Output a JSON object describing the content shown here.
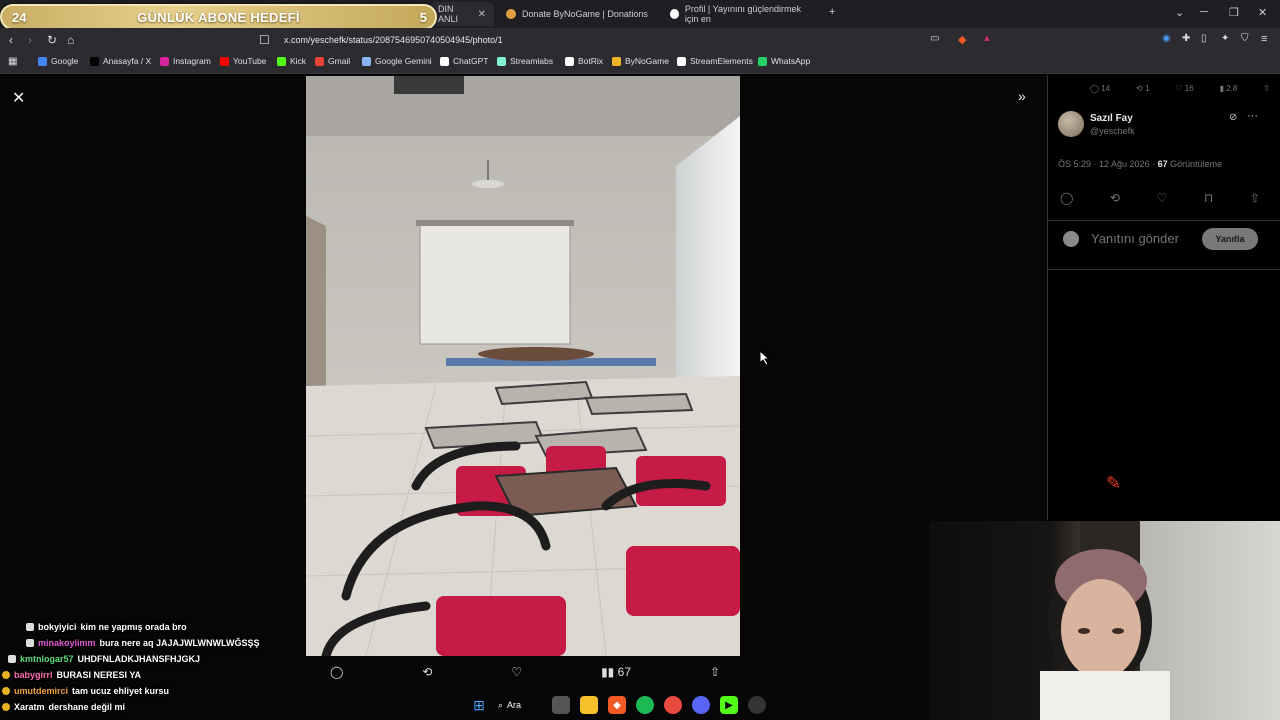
{
  "stream_goal": {
    "label": "GÜNLÜK ABONE HEDEFİ",
    "current": "24",
    "target": "5"
  },
  "tabs": [
    {
      "title": "DIN ANLI",
      "active": true
    },
    {
      "title": "Donate ByNoGame | Donations",
      "active": false
    },
    {
      "title": "Profil | Yayınını güçlendirmek için en",
      "active": false
    }
  ],
  "address_bar": {
    "url": "x.com/yeschefk/status/2087546950740504945/photo/1"
  },
  "bookmarks": [
    {
      "label": "Google",
      "color": "#4285f4"
    },
    {
      "label": "Anasayfa / X",
      "color": "#000000"
    },
    {
      "label": "Instagram",
      "color": "#d6249f"
    },
    {
      "label": "YouTube",
      "color": "#ff0000"
    },
    {
      "label": "Kick",
      "color": "#53fc18"
    },
    {
      "label": "Gmail",
      "color": "#ea4335"
    },
    {
      "label": "Google Gemini",
      "color": "#8ab4f8"
    },
    {
      "label": "ChatGPT",
      "color": "#ffffff"
    },
    {
      "label": "Streamlabs",
      "color": "#80f5d2"
    },
    {
      "label": "BotRix",
      "color": "#ffffff"
    },
    {
      "label": "ByNoGame",
      "color": "#f0b429"
    },
    {
      "label": "StreamElements",
      "color": "#ffffff"
    },
    {
      "label": "WhatsApp",
      "color": "#25d366"
    }
  ],
  "photo_actions": {
    "views": "67"
  },
  "post": {
    "stats": {
      "replies": "14",
      "reposts": "1",
      "likes": "16",
      "views": "2.8"
    },
    "author_name": "Sazıl Fay",
    "author_handle": "@yeschefk",
    "timestamp": "ÖS 5:29 · 12 Ağu 2026 ·",
    "view_count": "67",
    "view_label": "Görüntüleme"
  },
  "reply": {
    "placeholder": "Yanıtını gönder",
    "button": "Yanıtla"
  },
  "chat": [
    {
      "user": "bokyiyici",
      "message": "kim ne yapmış orada bro",
      "color": "#ffffff"
    },
    {
      "user": "minakoyiimm",
      "message": "bura nere aq JAJAJWLWNWLWĞSŞŞ",
      "color": "#e35bd8"
    },
    {
      "user": "kmtnlogar57",
      "message": "UHDFNLADKJHANSFHJGKJ",
      "color": "#5bdc7a"
    },
    {
      "user": "babygirrl",
      "message": "BURASI NERESI YA",
      "color": "#ff6fb5"
    },
    {
      "user": "umutdemirci",
      "message": "tam ucuz ehliyet kursu",
      "color": "#f0a040"
    },
    {
      "user": "Xaratm",
      "message": "dershane değil mi",
      "color": "#ffffff"
    }
  ],
  "taskbar": {
    "search_label": "Ara"
  },
  "colors": {
    "x_background": "#000000",
    "border": "#2f3336",
    "muted_text": "#71767b",
    "goal_gold": "#d9bf75",
    "brand_red": "#e53a1e"
  }
}
